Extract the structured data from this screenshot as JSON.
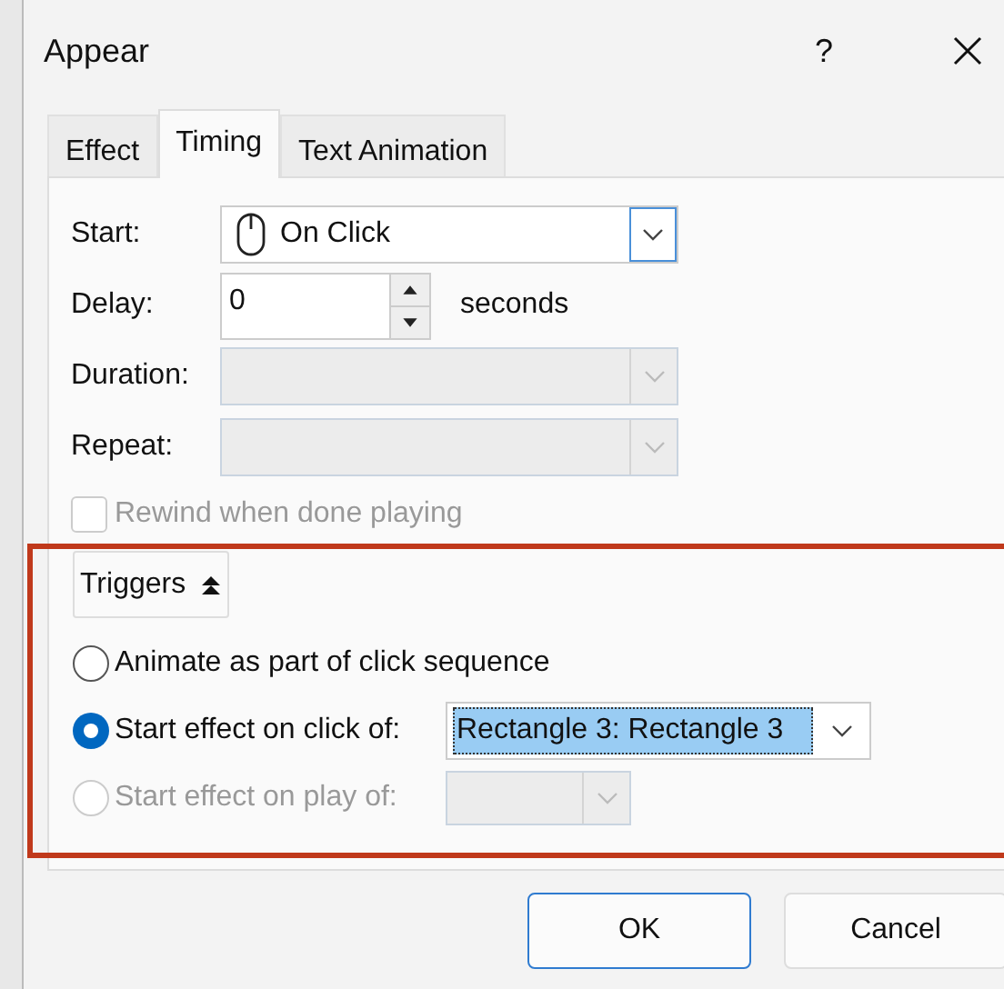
{
  "window": {
    "title": "Appear",
    "help": "?"
  },
  "tabs": [
    {
      "label": "Effect",
      "selected": false
    },
    {
      "label": "Timing",
      "selected": true
    },
    {
      "label": "Text Animation",
      "selected": false
    }
  ],
  "fields": [
    {
      "kind": "dropdown",
      "label": "Start:",
      "value": "On Click"
    },
    {
      "kind": "spinner",
      "label": "Delay:",
      "value": "0",
      "unit": "seconds"
    },
    {
      "kind": "dropdown",
      "label": "Duration:",
      "disabled": true
    },
    {
      "kind": "dropdown",
      "label": "Repeat:",
      "disabled": true
    }
  ],
  "rewind": {
    "label": "Rewind when done playing",
    "checked": false,
    "disabled": true
  },
  "triggers": {
    "label": "Triggers",
    "expanded": true,
    "options": [
      {
        "label": "Animate as part of click sequence",
        "selected": false
      },
      {
        "label": "Start effect on click of:",
        "selected": true,
        "dropdown": {
          "value": "Rectangle 3: Rectangle 3"
        }
      },
      {
        "label": "Start effect on play of:",
        "selected": false,
        "disabled": true,
        "dropdown": {
          "disabled": true
        }
      }
    ]
  },
  "buttons": [
    {
      "label": "OK",
      "default": true
    },
    {
      "label": "Cancel",
      "default": false
    }
  ]
}
